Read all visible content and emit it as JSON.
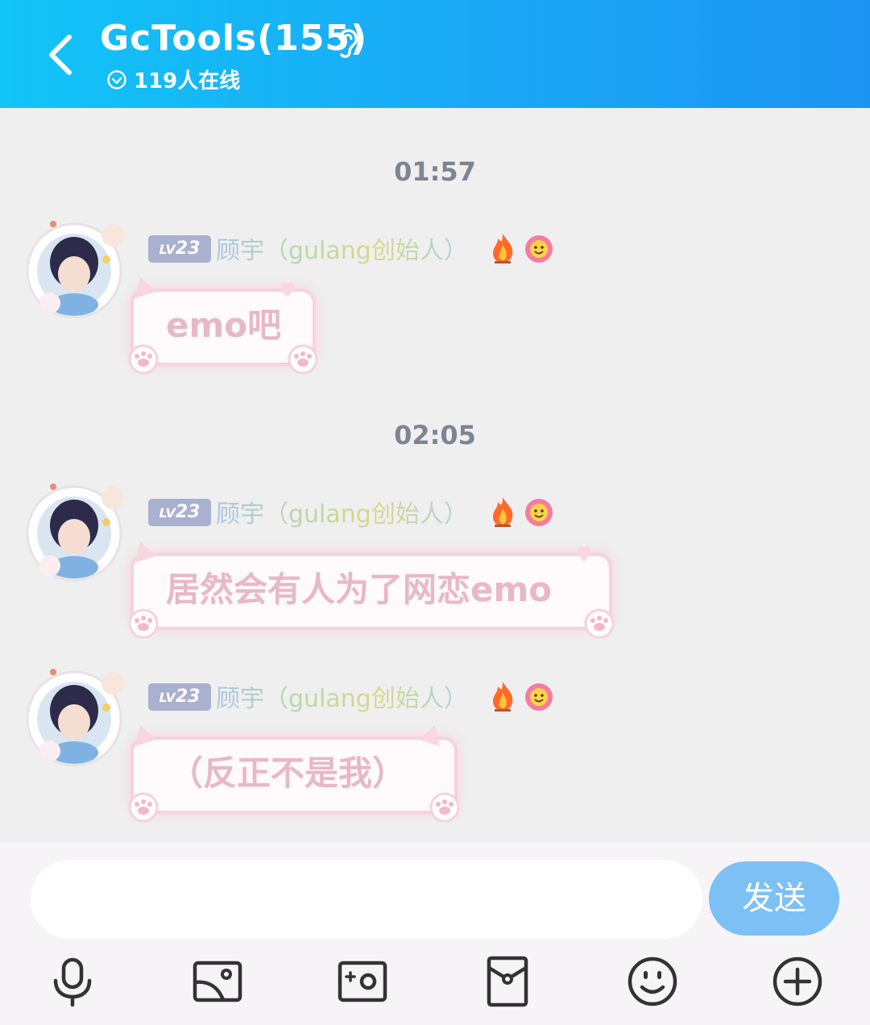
{
  "header": {
    "title": "GcTools(155)",
    "online": "119人在线"
  },
  "messages": [
    {
      "time": "01:57",
      "level_prefix": "LV",
      "level_num": "23",
      "sender": "顾宇（gulang创始人）",
      "text": "emo吧"
    },
    {
      "time": "02:05",
      "level_prefix": "LV",
      "level_num": "23",
      "sender": "顾宇（gulang创始人）",
      "text": "居然会有人为了网恋emo"
    },
    {
      "level_prefix": "LV",
      "level_num": "23",
      "sender": "顾宇（gulang创始人）",
      "text": "（反正不是我）"
    }
  ],
  "input": {
    "value": "",
    "send_label": "发送"
  },
  "toolbar": [
    "microphone-icon",
    "image-icon",
    "camera-icon",
    "red-packet-icon",
    "emoji-icon",
    "plus-icon"
  ],
  "colors": {
    "header_start": "#12c4f7",
    "header_end": "#1c95f2",
    "send_button": "#7cc0f5",
    "level_badge": "#aab0cf",
    "bubble_border": "#f6d2dc",
    "bubble_text": "#e8b8c6"
  }
}
